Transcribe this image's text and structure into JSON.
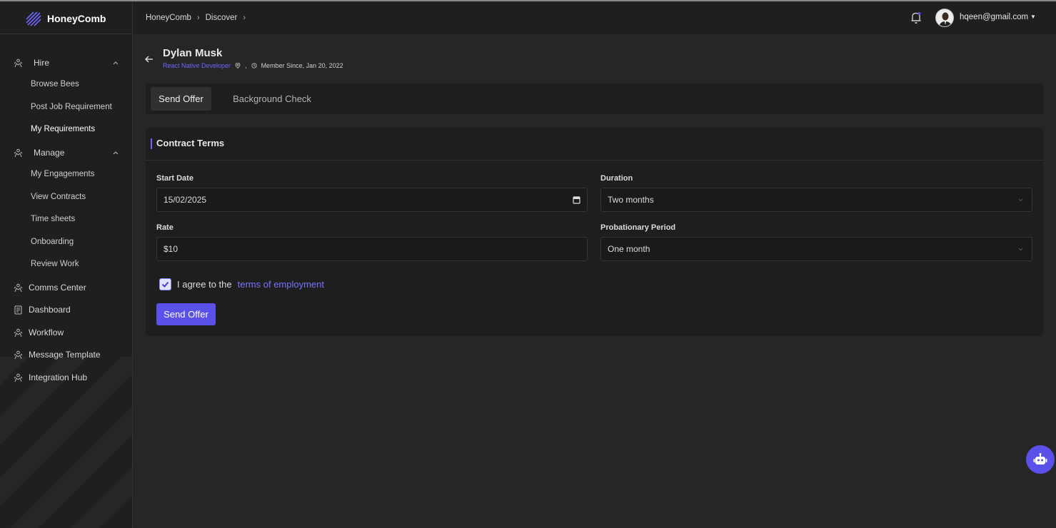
{
  "brand": {
    "name": "HoneyComb"
  },
  "breadcrumbs": [
    "HoneyComb",
    "Discover"
  ],
  "user": {
    "email": "hqeen@gmail.com"
  },
  "sidebar": {
    "groups": [
      {
        "label": "Hire",
        "items": [
          "Browse Bees",
          "Post Job Requirement",
          "My Requirements"
        ]
      },
      {
        "label": "Manage",
        "items": [
          "My Engagements",
          "View Contracts",
          "Time sheets",
          "Onboarding",
          "Review Work"
        ]
      }
    ],
    "links": [
      "Comms Center",
      "Dashboard",
      "Workflow",
      "Message Template",
      "Integration Hub"
    ]
  },
  "profile": {
    "name": "Dylan Musk",
    "role": "React Native Developer",
    "separator": ",",
    "member_since": "Member Since, Jan 20, 2022"
  },
  "tabs": [
    {
      "label": "Send Offer",
      "active": true
    },
    {
      "label": "Background Check",
      "active": false
    }
  ],
  "contract": {
    "title": "Contract Terms",
    "start_date_label": "Start Date",
    "start_date_value": "15/02/2025",
    "duration_label": "Duration",
    "duration_value": "Two months",
    "rate_label": "Rate",
    "rate_value": "$10",
    "probation_label": "Probationary Period",
    "probation_value": "One month",
    "agree_text": "I agree to the",
    "terms_link": "terms of employment",
    "agree_checked": true,
    "submit_label": "Send Offer"
  },
  "colors": {
    "accent": "#5b50e8",
    "link": "#7a72ff",
    "background": "#262626",
    "panel": "#1e1e1e"
  }
}
